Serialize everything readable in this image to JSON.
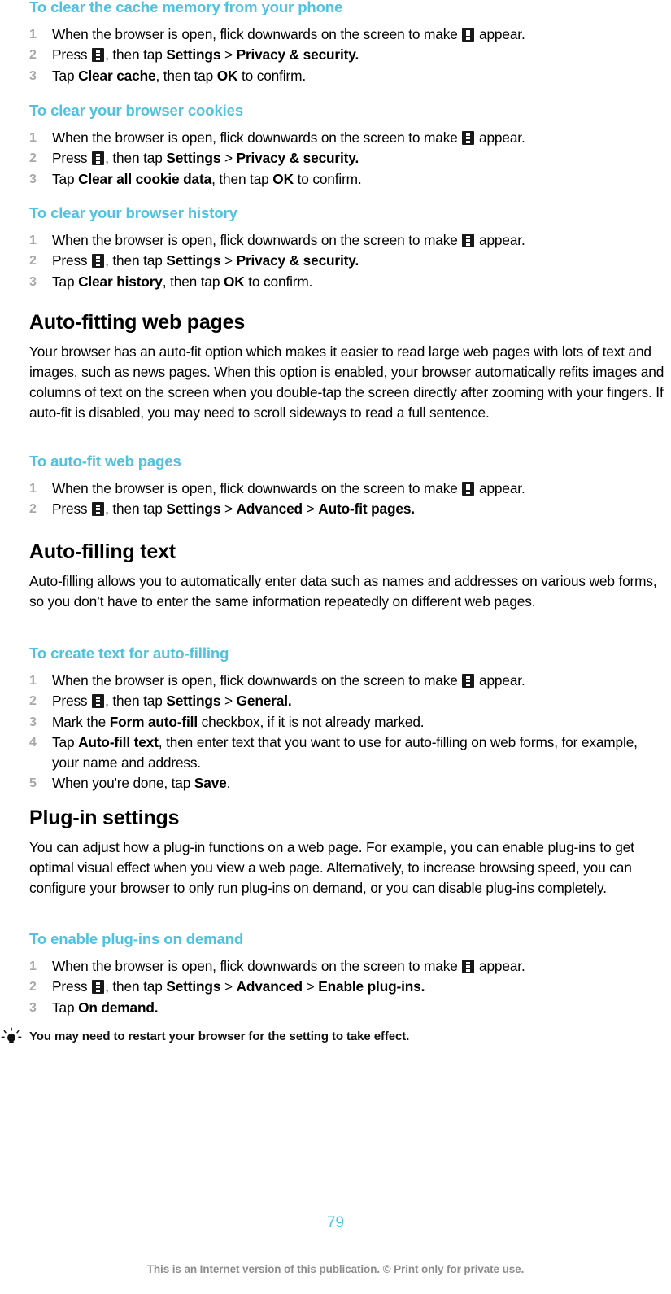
{
  "document": {
    "type": "user-guide-page",
    "accent_color": "#4ec2e0",
    "step_number_color": "#a8a8a8",
    "body_text_color": "#000000",
    "background_color": "#ffffff"
  },
  "icons": {
    "menu": "overflow-menu-icon",
    "tip": "lightbulb-icon"
  },
  "sections": [
    {
      "id": "clear-cache",
      "kind": "procedure",
      "title": "To clear the cache memory from your phone",
      "steps": [
        "When the browser is open, flick downwards on the screen to make   appear.",
        "Press  , then tap Settings > Privacy & security.",
        "Tap Clear cache, then tap OK to confirm."
      ]
    },
    {
      "id": "clear-cookies",
      "kind": "procedure",
      "title": "To clear your browser cookies",
      "steps": [
        "When the browser is open, flick downwards on the screen to make   appear.",
        "Press  , then tap Settings > Privacy & security.",
        "Tap Clear all cookie data, then tap OK to confirm."
      ]
    },
    {
      "id": "clear-history",
      "kind": "procedure",
      "title": "To clear your browser history",
      "steps": [
        "When the browser is open, flick downwards on the screen to make   appear.",
        "Press  , then tap Settings > Privacy & security.",
        "Tap Clear history, then tap OK to confirm."
      ]
    },
    {
      "id": "auto-fitting-web-pages",
      "kind": "section",
      "title": "Auto-fitting web pages",
      "body": "Your browser has an auto-fit option which makes it easier to read large web pages with lots of text and images, such as news pages. When this option is enabled, your browser automatically refits images and columns of text on the screen when you double-tap the screen directly after zooming with your fingers. If auto-fit is disabled, you may need to scroll sideways to read a full sentence."
    },
    {
      "id": "to-auto-fit-web-pages",
      "kind": "procedure",
      "title": "To auto-fit web pages",
      "steps": [
        "When the browser is open, flick downwards on the screen to make   appear.",
        "Press  , then tap Settings > Advanced > Auto-fit pages."
      ]
    },
    {
      "id": "auto-filling-text",
      "kind": "section",
      "title": "Auto-filling text",
      "body": "Auto-filling allows you to automatically enter data such as names and addresses on various web forms, so you don’t have to enter the same information repeatedly on different web pages."
    },
    {
      "id": "to-create-text-for-auto-filling",
      "kind": "procedure",
      "title": "To create text for auto-filling",
      "steps": [
        "When the browser is open, flick downwards on the screen to make   appear.",
        "Press  , then tap Settings > General.",
        "Mark the Form auto-fill checkbox, if it is not already marked.",
        "Tap Auto-fill text, then enter text that you want to use for auto-filling on web forms, for example, your name and address.",
        "When you're done, tap Save."
      ]
    },
    {
      "id": "plug-in-settings",
      "kind": "section",
      "title": "Plug-in settings",
      "body": "You can adjust how a plug-in functions on a web page. For example, you can enable plug-ins to get optimal visual effect when you view a web page. Alternatively, to increase browsing speed, you can configure your browser to only run plug-ins on demand, or you can disable plug-ins completely."
    },
    {
      "id": "to-enable-plug-ins-on-demand",
      "kind": "procedure",
      "title": "To enable plug-ins on demand",
      "steps": [
        "When the browser is open, flick downwards on the screen to make   appear.",
        "Press  , then tap Settings > Advanced > Enable plug-ins.",
        "Tap On demand."
      ]
    }
  ],
  "text": {
    "s1_title": "To clear the cache memory from your phone",
    "s2_title": "To clear your browser cookies",
    "s3_title": "To clear your browser history",
    "s4_title": "Auto-fitting web pages",
    "s4_body": "Your browser has an auto-fit option which makes it easier to read large web pages with lots of text and images, such as news pages. When this option is enabled, your browser automatically refits images and columns of text on the screen when you double-tap the screen directly after zooming with your fingers. If auto-fit is disabled, you may need to scroll sideways to read a full sentence.",
    "s5_title": "To auto-fit web pages",
    "s6_title": "Auto-filling text",
    "s6_body": "Auto-filling allows you to automatically enter data such as names and addresses on various web forms, so you don’t have to enter the same information repeatedly on different web pages.",
    "s7_title": "To create text for auto-filling",
    "s8_title": "Plug-in settings",
    "s8_body": "You can adjust how a plug-in functions on a web page. For example, you can enable plug-ins to get optimal visual effect when you view a web page. Alternatively, to increase browsing speed, you can configure your browser to only run plug-ins on demand, or you can disable plug-ins completely.",
    "s9_title": "To enable plug-ins on demand"
  },
  "fragments": {
    "flick_pre": "When the browser is open, flick downwards on the screen to make",
    "flick_post": "appear.",
    "press_pre": "Press",
    "press_post": ", then tap",
    "settings": "Settings",
    "gt": ">",
    "privacy_security": "Privacy & security.",
    "advanced": "Advanced",
    "auto_fit_pages": "Auto-fit pages.",
    "general": "General.",
    "enable_plugins": "Enable plug-ins.",
    "tap": "Tap",
    "clear_cache": "Clear cache",
    "clear_all_cookie_data": "Clear all cookie data",
    "clear_history": "Clear history",
    "then_tap": ", then tap",
    "ok": "OK",
    "to_confirm": "to confirm.",
    "mark_the": "Mark the",
    "form_auto_fill": "Form auto-fill",
    "checkbox_rest": "checkbox, if it is not already marked.",
    "auto_fill_text": "Auto-fill text",
    "auto_fill_rest_1": ", then enter text that you want to use for auto-filling on web",
    "auto_fill_rest_2": "forms, for example, your name and address.",
    "when_done": "When you're done, tap",
    "save": "Save",
    "period": ".",
    "on_demand": "On demand."
  },
  "tip": {
    "text": "You may need to restart your browser for the setting to take effect."
  },
  "footer": {
    "page_number": "79",
    "copyright": "This is an Internet version of this publication. © Print only for private use."
  },
  "steps_numbers": [
    "1",
    "2",
    "3",
    "4",
    "5"
  ]
}
